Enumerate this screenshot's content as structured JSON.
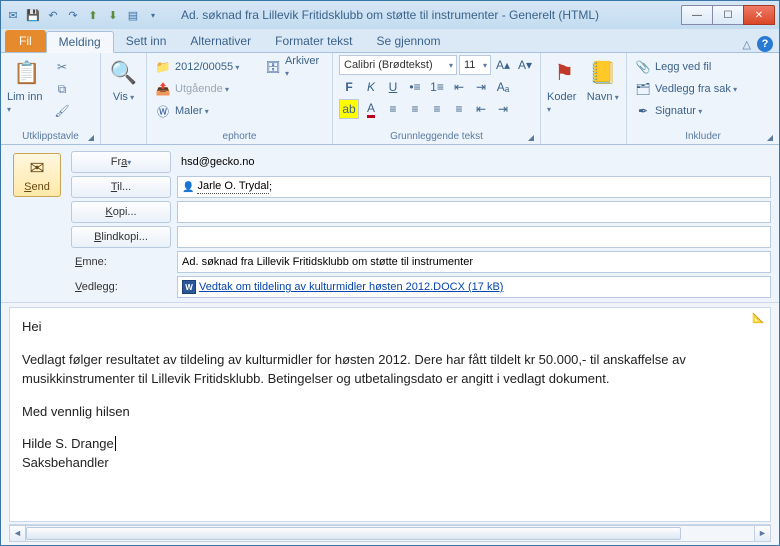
{
  "window": {
    "title": "Ad. søknad fra Lillevik Fritidsklubb om støtte til instrumenter - Generelt (HTML)"
  },
  "tabs": {
    "file": "Fil",
    "t1": "Melding",
    "t2": "Sett inn",
    "t3": "Alternativer",
    "t4": "Formater tekst",
    "t5": "Se gjennom"
  },
  "groups": {
    "clipboard": {
      "label": "Utklippstavle",
      "paste": "Lim inn",
      "view": "Vis"
    },
    "ephorte": {
      "label": "ephorte",
      "docnum": "2012/00055",
      "outgoing": "Utgående",
      "templates": "Maler",
      "archive": "Arkiver"
    },
    "font": {
      "label": "Grunnleggende tekst",
      "family": "Calibri (Brødtekst)",
      "size": "11"
    },
    "names": {
      "koder": "Koder",
      "navn": "Navn"
    },
    "include": {
      "label": "Inkluder",
      "attach_file": "Legg ved fil",
      "attach_case": "Vedlegg fra sak",
      "signature": "Signatur"
    }
  },
  "compose": {
    "send": "Send",
    "from_btn": "Fra",
    "from_value": "hsd@gecko.no",
    "to_btn": "Til...",
    "to_value": "Jarle O. Trydal",
    "cc_btn": "Kopi...",
    "bcc_btn": "Blindkopi...",
    "subject_label": "Emne:",
    "subject_value": "Ad. søknad fra Lillevik Fritidsklubb om støtte til instrumenter",
    "attach_label": "Vedlegg:",
    "attach_name": "Vedtak om tildeling av kulturmidler høsten 2012.DOCX (17 kB)"
  },
  "body": {
    "greeting": "Hei",
    "para": "Vedlagt følger resultatet av tildeling av kulturmidler for høsten 2012. Dere har fått tildelt kr 50.000,- til anskaffelse av musikkinstrumenter til Lillevik Fritidsklubb. Betingelser og utbetalingsdato er angitt i vedlagt dokument.",
    "closing": "Med vennlig hilsen",
    "name": "Hilde S. Drange",
    "role": "Saksbehandler"
  }
}
